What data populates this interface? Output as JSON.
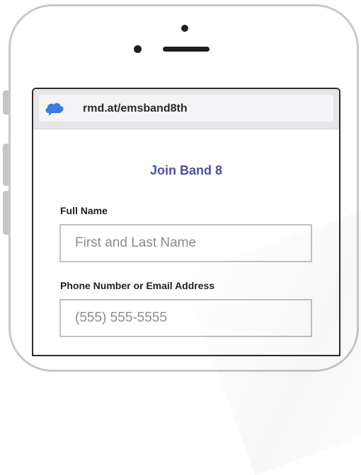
{
  "browser": {
    "url": "rmd.at/emsband8th",
    "icon": "cloud-icon",
    "icon_color": "#3b7be6"
  },
  "form": {
    "title": "Join Band 8",
    "title_color": "#4b50a6",
    "fields": [
      {
        "label": "Full Name",
        "placeholder": "First and Last Name"
      },
      {
        "label": "Phone Number or Email Address",
        "placeholder": "(555) 555-5555"
      }
    ]
  }
}
